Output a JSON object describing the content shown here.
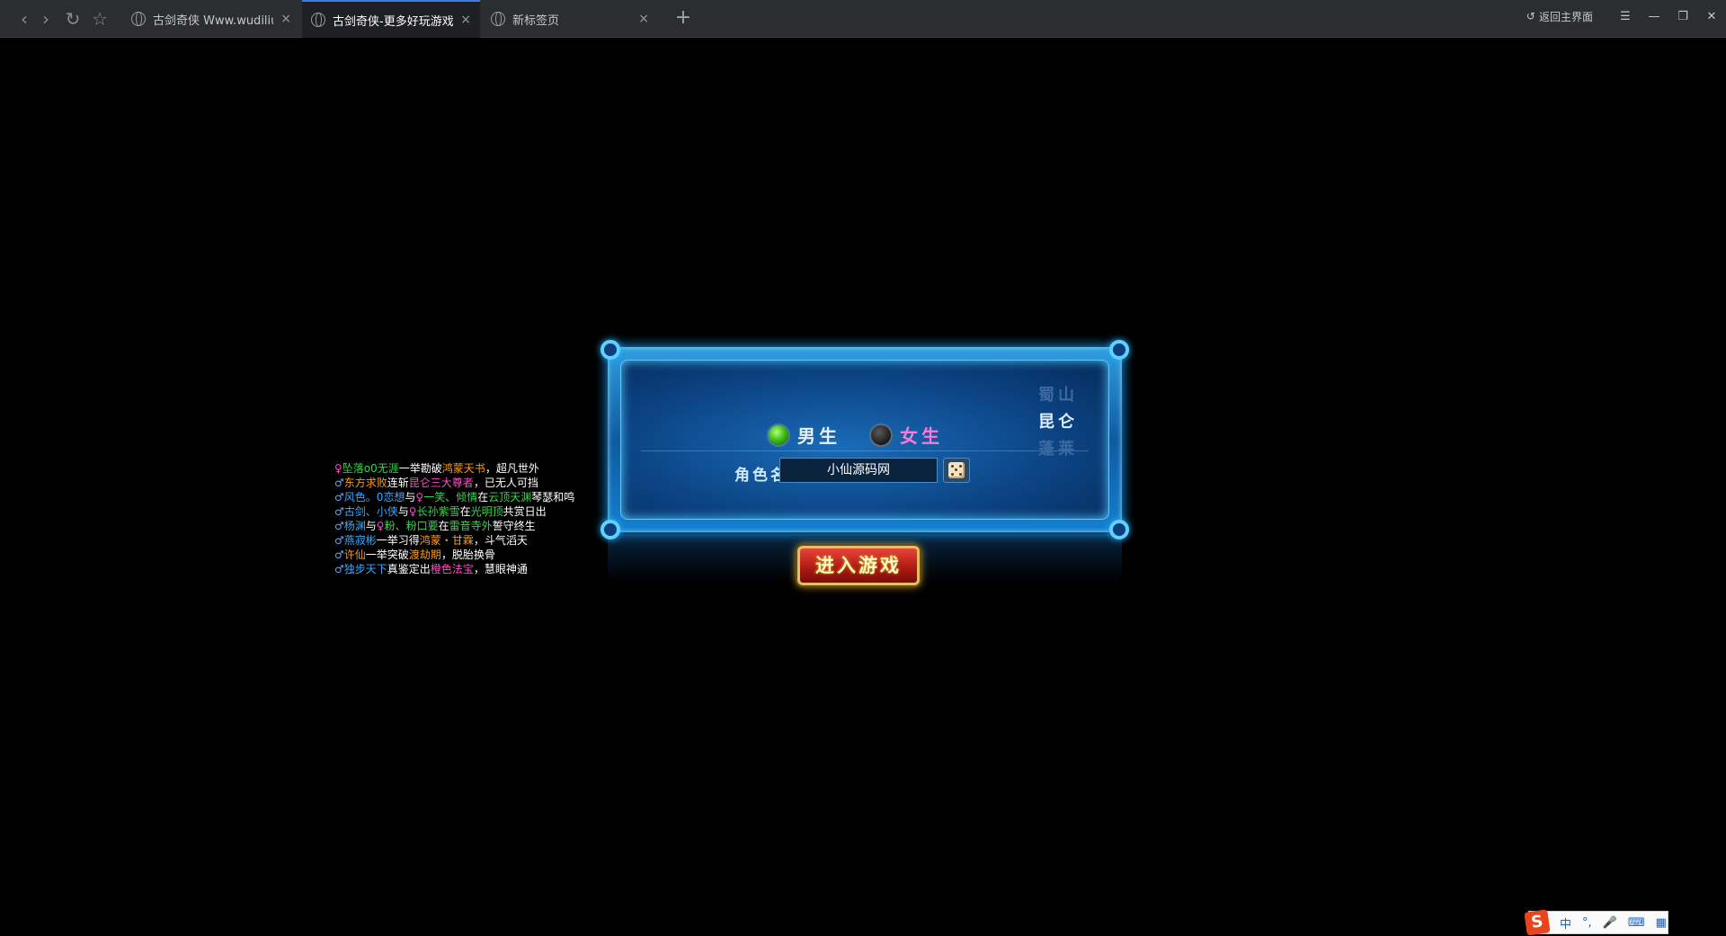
{
  "browser": {
    "tabs": [
      {
        "title": "古剑奇侠 Www.wudiliu....",
        "close": "×"
      },
      {
        "title": "古剑奇侠-更多好玩游戏-...",
        "close": "×"
      },
      {
        "title": "新标签页",
        "close": "×"
      }
    ],
    "new_tab": "+",
    "back_home": "返回主界面",
    "menu": "☰",
    "minimize": "—",
    "restore": "❐",
    "close_window": "✕",
    "nav_back": "‹",
    "nav_forward": "›",
    "reload": "↻",
    "favorite": "☆"
  },
  "feed": {
    "lines": [
      [
        {
          "t": "♀",
          "c": "#ff4bc8"
        },
        {
          "t": "坠落o0无涯",
          "c": "#36d84a"
        },
        {
          "t": "一举勘破",
          "c": "#ffffff"
        },
        {
          "t": "鸿蒙天书",
          "c": "#ff9a1a"
        },
        {
          "t": "，超凡世外",
          "c": "#ffffff"
        }
      ],
      [
        {
          "t": "♂",
          "c": "#5fa8ff"
        },
        {
          "t": "东方求败",
          "c": "#ff9a1a"
        },
        {
          "t": "连斩",
          "c": "#ffffff"
        },
        {
          "t": "昆仑三大尊者",
          "c": "#ff4bc8"
        },
        {
          "t": "，已无人可挡",
          "c": "#ffffff"
        }
      ],
      [
        {
          "t": "♂",
          "c": "#5fa8ff"
        },
        {
          "t": "风色。0恋想",
          "c": "#3aa8ff"
        },
        {
          "t": "与",
          "c": "#ffffff"
        },
        {
          "t": "♀",
          "c": "#ff4bc8"
        },
        {
          "t": "一笑、倾情",
          "c": "#36d84a"
        },
        {
          "t": "在",
          "c": "#ffffff"
        },
        {
          "t": "云顶天渊",
          "c": "#36d84a"
        },
        {
          "t": "琴瑟和鸣",
          "c": "#ffffff"
        }
      ],
      [
        {
          "t": "♂",
          "c": "#5fa8ff"
        },
        {
          "t": "古剑、小侠",
          "c": "#3aa8ff"
        },
        {
          "t": "与",
          "c": "#ffffff"
        },
        {
          "t": "♀",
          "c": "#ff4bc8"
        },
        {
          "t": "长孙紫雪",
          "c": "#36d84a"
        },
        {
          "t": "在",
          "c": "#ffffff"
        },
        {
          "t": "光明顶",
          "c": "#36d84a"
        },
        {
          "t": "共赏日出",
          "c": "#ffffff"
        }
      ],
      [
        {
          "t": "♂",
          "c": "#5fa8ff"
        },
        {
          "t": "杨渊",
          "c": "#3aa8ff"
        },
        {
          "t": "与",
          "c": "#ffffff"
        },
        {
          "t": "♀",
          "c": "#ff4bc8"
        },
        {
          "t": "粉、粉口要",
          "c": "#36d84a"
        },
        {
          "t": "在",
          "c": "#ffffff"
        },
        {
          "t": "雷音寺外",
          "c": "#36d84a"
        },
        {
          "t": "誓守终生",
          "c": "#ffffff"
        }
      ],
      [
        {
          "t": "♂",
          "c": "#5fa8ff"
        },
        {
          "t": "燕寂彬",
          "c": "#3aa8ff"
        },
        {
          "t": "一举习得",
          "c": "#ffffff"
        },
        {
          "t": "鸿蒙・甘霖",
          "c": "#ff9a1a"
        },
        {
          "t": "，斗气滔天",
          "c": "#ffffff"
        }
      ],
      [
        {
          "t": "♂",
          "c": "#5fa8ff"
        },
        {
          "t": "许仙",
          "c": "#ff9a1a"
        },
        {
          "t": "一举突破",
          "c": "#ffffff"
        },
        {
          "t": "渡劫期",
          "c": "#ff9a1a"
        },
        {
          "t": "，脱胎换骨",
          "c": "#ffffff"
        }
      ],
      [
        {
          "t": "♂",
          "c": "#5fa8ff"
        },
        {
          "t": "独步天下",
          "c": "#3aa8ff"
        },
        {
          "t": "真鉴定出",
          "c": "#ffffff"
        },
        {
          "t": "橙色法宝",
          "c": "#ff4bc8"
        },
        {
          "t": "，慧眼神通",
          "c": "#ffffff"
        }
      ]
    ]
  },
  "login": {
    "male_label": "男生",
    "female_label": "女生",
    "male_color": "#e8f0ff",
    "female_color": "#ff7ad8",
    "name_label": "角色名",
    "name_value": "小仙源码网",
    "sects": [
      {
        "label": "蜀山",
        "color": "#3c6aa0"
      },
      {
        "label": "昆仑",
        "color": "#e0f0ff"
      },
      {
        "label": "蓬莱",
        "color": "#3c6aa0"
      }
    ],
    "enter_button": "进入游戏"
  },
  "ime": {
    "logo": "S",
    "lang": "中",
    "punct": "°,",
    "voice": "🎤",
    "keyboard": "⌨",
    "tools": "▦"
  }
}
